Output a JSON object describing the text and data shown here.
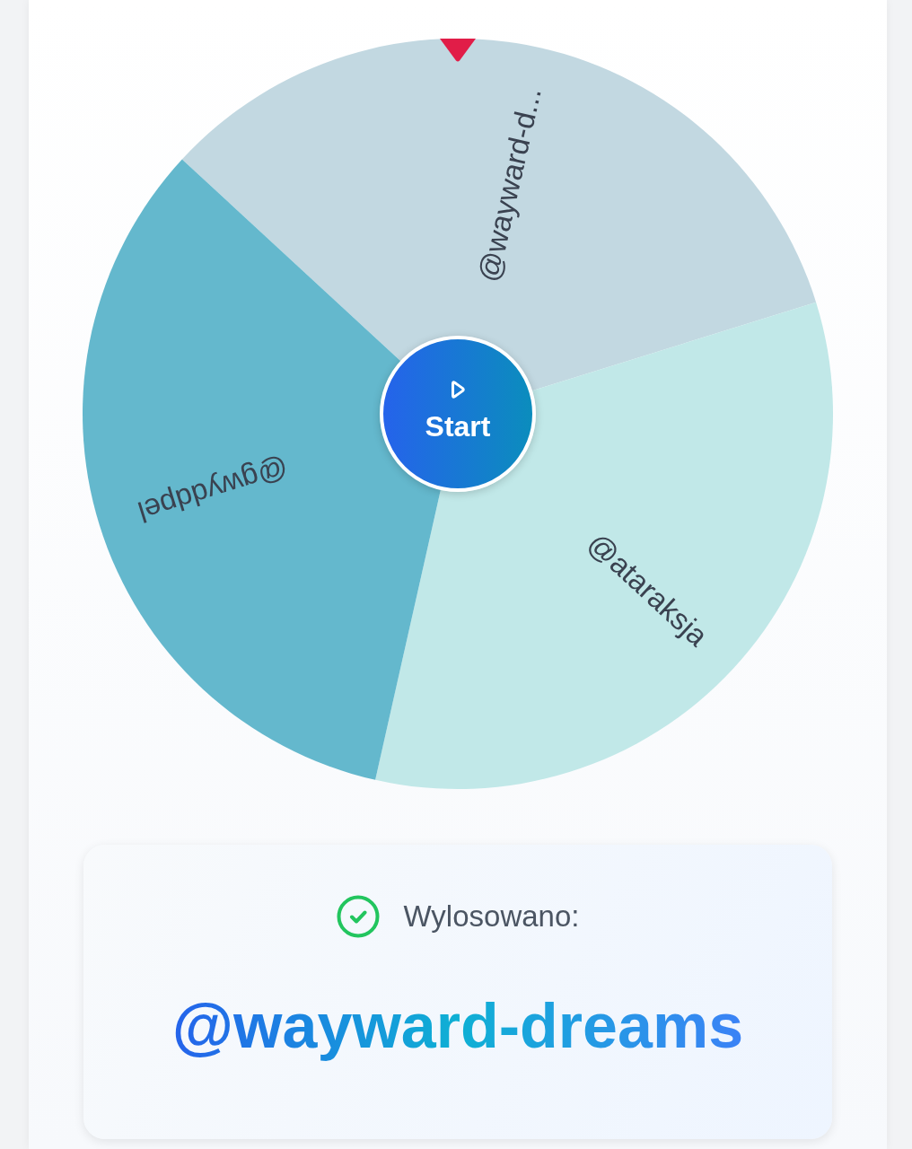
{
  "wheel": {
    "segments": [
      {
        "label": "@wayward-d...",
        "color": "#c2d8e1"
      },
      {
        "label": "@ataraksja",
        "color": "#c1e8e8"
      },
      {
        "label": "@gwyddpel",
        "color": "#64b8cd"
      }
    ],
    "start_button": {
      "label": "Start"
    }
  },
  "result": {
    "heading": "Wylosowano:",
    "winner": "@wayward-dreams"
  }
}
